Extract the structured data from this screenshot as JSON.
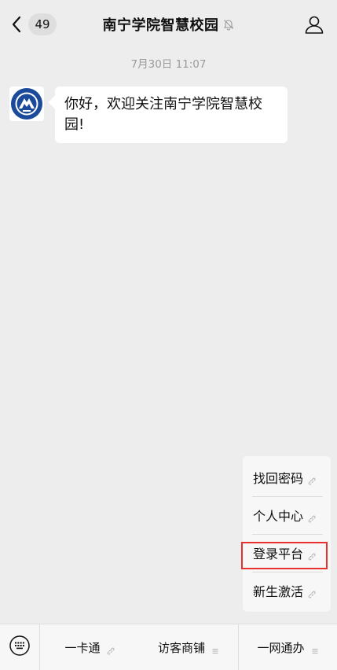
{
  "header": {
    "back_count": "49",
    "title": "南宁学院智慧校园"
  },
  "chat": {
    "timestamp": "7月30日 11:07",
    "message": "你好，欢迎关注南宁学院智慧校园!"
  },
  "popup": {
    "items": [
      {
        "label": "找回密码",
        "icon": "link-icon"
      },
      {
        "label": "个人中心",
        "icon": "link-icon"
      },
      {
        "label": "登录平台",
        "icon": "link-icon",
        "highlighted": true
      },
      {
        "label": "新生激活",
        "icon": "link-icon"
      }
    ]
  },
  "bottom_menu": {
    "items": [
      {
        "label": "一卡通",
        "icon": "link-icon"
      },
      {
        "label": "访客商铺",
        "icon": "menu-lines-icon"
      },
      {
        "label": "一网通办",
        "icon": "menu-lines-icon"
      }
    ]
  },
  "colors": {
    "background": "#ededed",
    "highlight": "#e8302f",
    "logo_blue": "#1b4a9a"
  }
}
